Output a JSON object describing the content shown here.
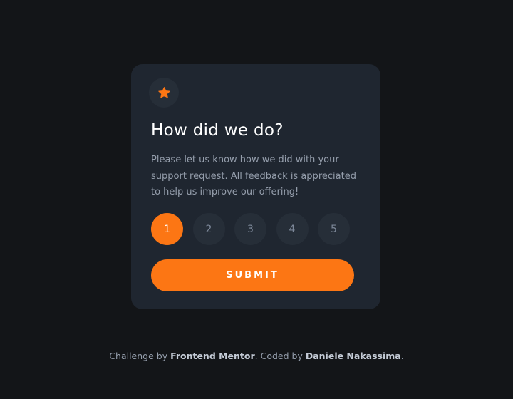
{
  "card": {
    "icon": "star-icon",
    "title": "How did we do?",
    "description": "Please let us know how we did with your support request. All feedback is appreciated to help us improve our offering!",
    "ratings": [
      "1",
      "2",
      "3",
      "4",
      "5"
    ],
    "selected_rating": "1",
    "submit_label": "SUBMIT"
  },
  "footer": {
    "prefix": "Challenge by ",
    "challenge_link": "Frontend Mentor",
    "middle": ". Coded by ",
    "author_link": "Daniele Nakassima",
    "suffix": "."
  },
  "colors": {
    "page_background": "#131518",
    "card_background": "#1f2630",
    "accent": "#fc7614",
    "muted_text": "#959eac",
    "rating_background": "#262e38"
  }
}
